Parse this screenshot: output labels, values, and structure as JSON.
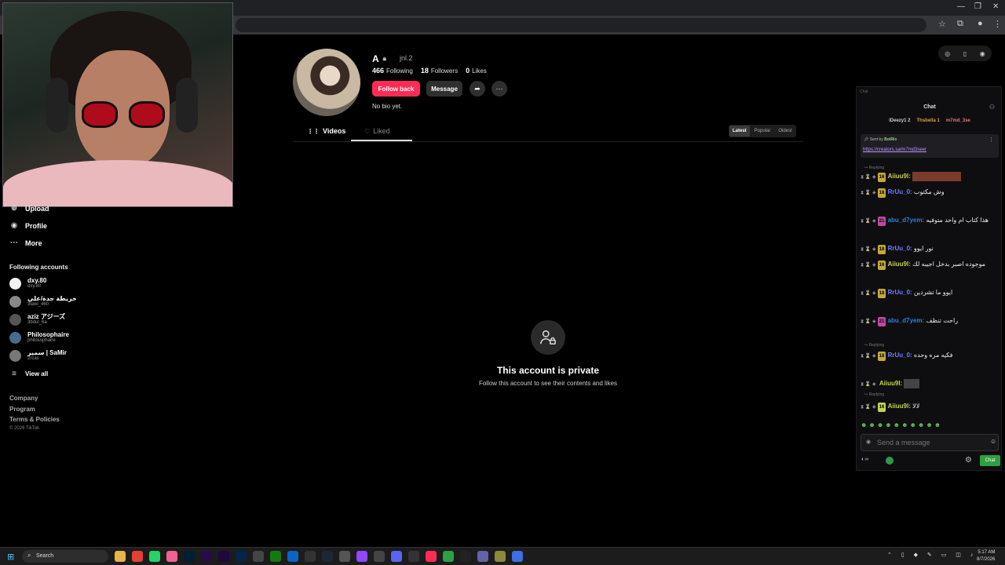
{
  "browser": {
    "window_controls": {
      "minimize": "—",
      "restore": "❐",
      "close": "✕"
    },
    "toolbar_icons": [
      "star-icon",
      "extension-icon",
      "profile-icon",
      "kebab-menu-icon"
    ]
  },
  "sidebar": {
    "nav": [
      {
        "label": "Upload",
        "icon": "upload-icon"
      },
      {
        "label": "Profile",
        "icon": "profile-icon"
      },
      {
        "label": "More",
        "icon": "more-icon"
      }
    ],
    "following_heading": "Following accounts",
    "accounts": [
      {
        "name": "dxy.80",
        "handle": "dxy.80",
        "color": "#f2f2f2"
      },
      {
        "name": "خريطة جدة/علي",
        "handle": "3lawi_460",
        "color": "#888888"
      },
      {
        "name": "aziz アジーズ",
        "handle": "3bdul_6a",
        "color": "#555555"
      },
      {
        "name": "Philosophaire",
        "handle": "philosophaire",
        "color": "#4a6b8a"
      },
      {
        "name": "سمير | SaMir",
        "handle": "2rcas",
        "color": "#777777"
      }
    ],
    "view_all": "View all",
    "footer": [
      "Company",
      "Program",
      "Terms & Policies"
    ],
    "copyright": "© 2026 TikTok"
  },
  "profile": {
    "display_name": "A",
    "handle": "jnl.2",
    "stats": [
      {
        "value": "466",
        "label": "Following"
      },
      {
        "value": "18",
        "label": "Followers"
      },
      {
        "value": "0",
        "label": "Likes"
      }
    ],
    "follow_back": "Follow back",
    "message": "Message",
    "bio": "No bio yet.",
    "tabs": {
      "videos": "Videos",
      "liked": "Liked"
    },
    "sort": [
      "Latest",
      "Popular",
      "Oldest"
    ],
    "private_title": "This account is private",
    "private_sub": "Follow this account to see their contents and likes",
    "accent": "#fe2c55"
  },
  "chat": {
    "top_label": "Chat",
    "title": "Chat",
    "gifters": [
      {
        "name": "iDeezy1",
        "count": "2",
        "color": "#cfcfcf"
      },
      {
        "name": "Thsbella",
        "count": "1",
        "color": "#d9a441"
      },
      {
        "name": "m7md_3se",
        "count": "",
        "color": "#e07b7b"
      }
    ],
    "pinned_sent_by": "Sent by",
    "pinned_sender": "BotRix",
    "pinned_link": "https://creators.sa/m7md3seer",
    "messages": [
      {
        "badge": "16",
        "user": "Aiiuu9l:",
        "user_color": "#c4d34f",
        "text": ""
      },
      {
        "badge": "18",
        "user": "RrUu_0:",
        "user_color": "#6f7dff",
        "text": "وش مكتوب"
      },
      {
        "badge": "21",
        "user": "abu_d7yem:",
        "user_color": "#2f7fd9",
        "text": "هذا كتاب ام واحد متوفيه"
      },
      {
        "badge": "18",
        "user": "RrUu_0:",
        "user_color": "#6f7dff",
        "text": "نور ايوو"
      },
      {
        "badge": "16",
        "user": "Aiiuu9l:",
        "user_color": "#c4d34f",
        "text": "موجوده اصبر بدخل اجيبه لك"
      },
      {
        "badge": "18",
        "user": "RrUu_0:",
        "user_color": "#6f7dff",
        "text": "ايوو ما تشردين"
      },
      {
        "badge": "21",
        "user": "abu_d7yem:",
        "user_color": "#2f7fd9",
        "text": "راحت تنظف"
      },
      {
        "badge": "18",
        "user": "RrUu_0:",
        "user_color": "#6f7dff",
        "text": "فكيه مره وحده"
      },
      {
        "badge": "16",
        "user": "Aiiuu9l:",
        "user_color": "#c4d34f",
        "text": ""
      },
      {
        "badge": "16",
        "user": "Aiiuu9l:",
        "user_color": "#c4d34f",
        "text": "لالا"
      }
    ],
    "input_placeholder": "Send a message",
    "send_label": "Chat"
  },
  "taskbar": {
    "search": "Search",
    "time": "5:17 AM",
    "date": "8/7/2026"
  }
}
